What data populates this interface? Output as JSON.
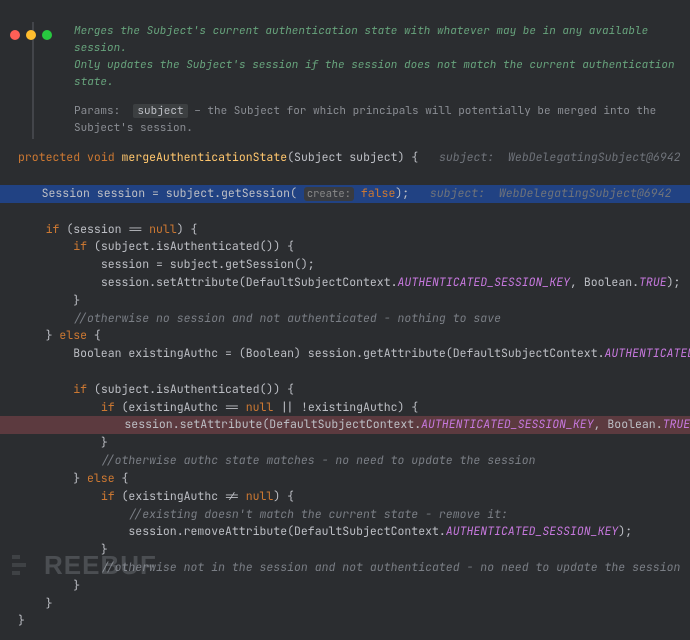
{
  "window": {
    "title": "code-editor"
  },
  "doc": {
    "line1": "Merges the Subject's current authentication state with whatever may be in any available session.",
    "line2": "Only updates the Subject's session if the session does not match the current authentication state.",
    "paramsLabel": "Params:",
    "paramName": "subject",
    "paramDesc": " – the Subject for which principals will potentially be merged into the Subject's session."
  },
  "sig": {
    "mod1": "protected",
    "mod2": "void",
    "method": "mergeAuthenticationState",
    "paramType": "Subject",
    "paramName": "subject",
    "hintLabel": "subject:",
    "hintValue": "WebDelegatingSubject@6942"
  },
  "l_session_decl_a": "Session session = subject.getSession(",
  "l_session_decl_hint": "create:",
  "l_session_decl_false": "false",
  "l_session_decl_b": ");",
  "l_session_hint_label": "subject:",
  "l_session_hint_value": "WebDelegatingSubject@6942",
  "kw_if": "if",
  "kw_else": "else",
  "kw_null": "null",
  "l_if_session_null": " (session == ",
  "l_if_authenticated": " (subject.isAuthenticated()) {",
  "l_get_session": "session = subject.getSession();",
  "l_set_attr_a": "session.setAttribute(DefaultSubjectContext.",
  "l_auth_key": "AUTHENTICATED_SESSION_KEY",
  "l_set_attr_b": ", Boolean.",
  "l_true": "TRUE",
  "l_close_paren": ");",
  "l_close_brace": "}",
  "l_comment_no_session": "//otherwise no session and not authenticated - nothing to save",
  "l_else": " {",
  "l_existing_a": "Boolean existingAuthc = (Boolean) session.getAttribute(DefaultSubjectContext.",
  "l_existing_b": ");",
  "l_if_existing_null_a": " (existingAuthc == ",
  "l_if_existing_null_b": " || !existingAuthc) {",
  "l_comment_matches": "//otherwise authc state matches - no need to update the session",
  "l_if_existing_notnull_a": " (existingAuthc != ",
  "l_if_existing_notnull_b": ") {",
  "l_comment_remove": "//existing doesn't match the current state - remove it:",
  "l_remove_attr_a": "session.removeAttribute(DefaultSubjectContext.",
  "l_remove_attr_b": ");",
  "l_comment_not_in_session": "//otherwise not in the session and not authenticated - no need to update the session",
  "watermark": "REEBUF"
}
